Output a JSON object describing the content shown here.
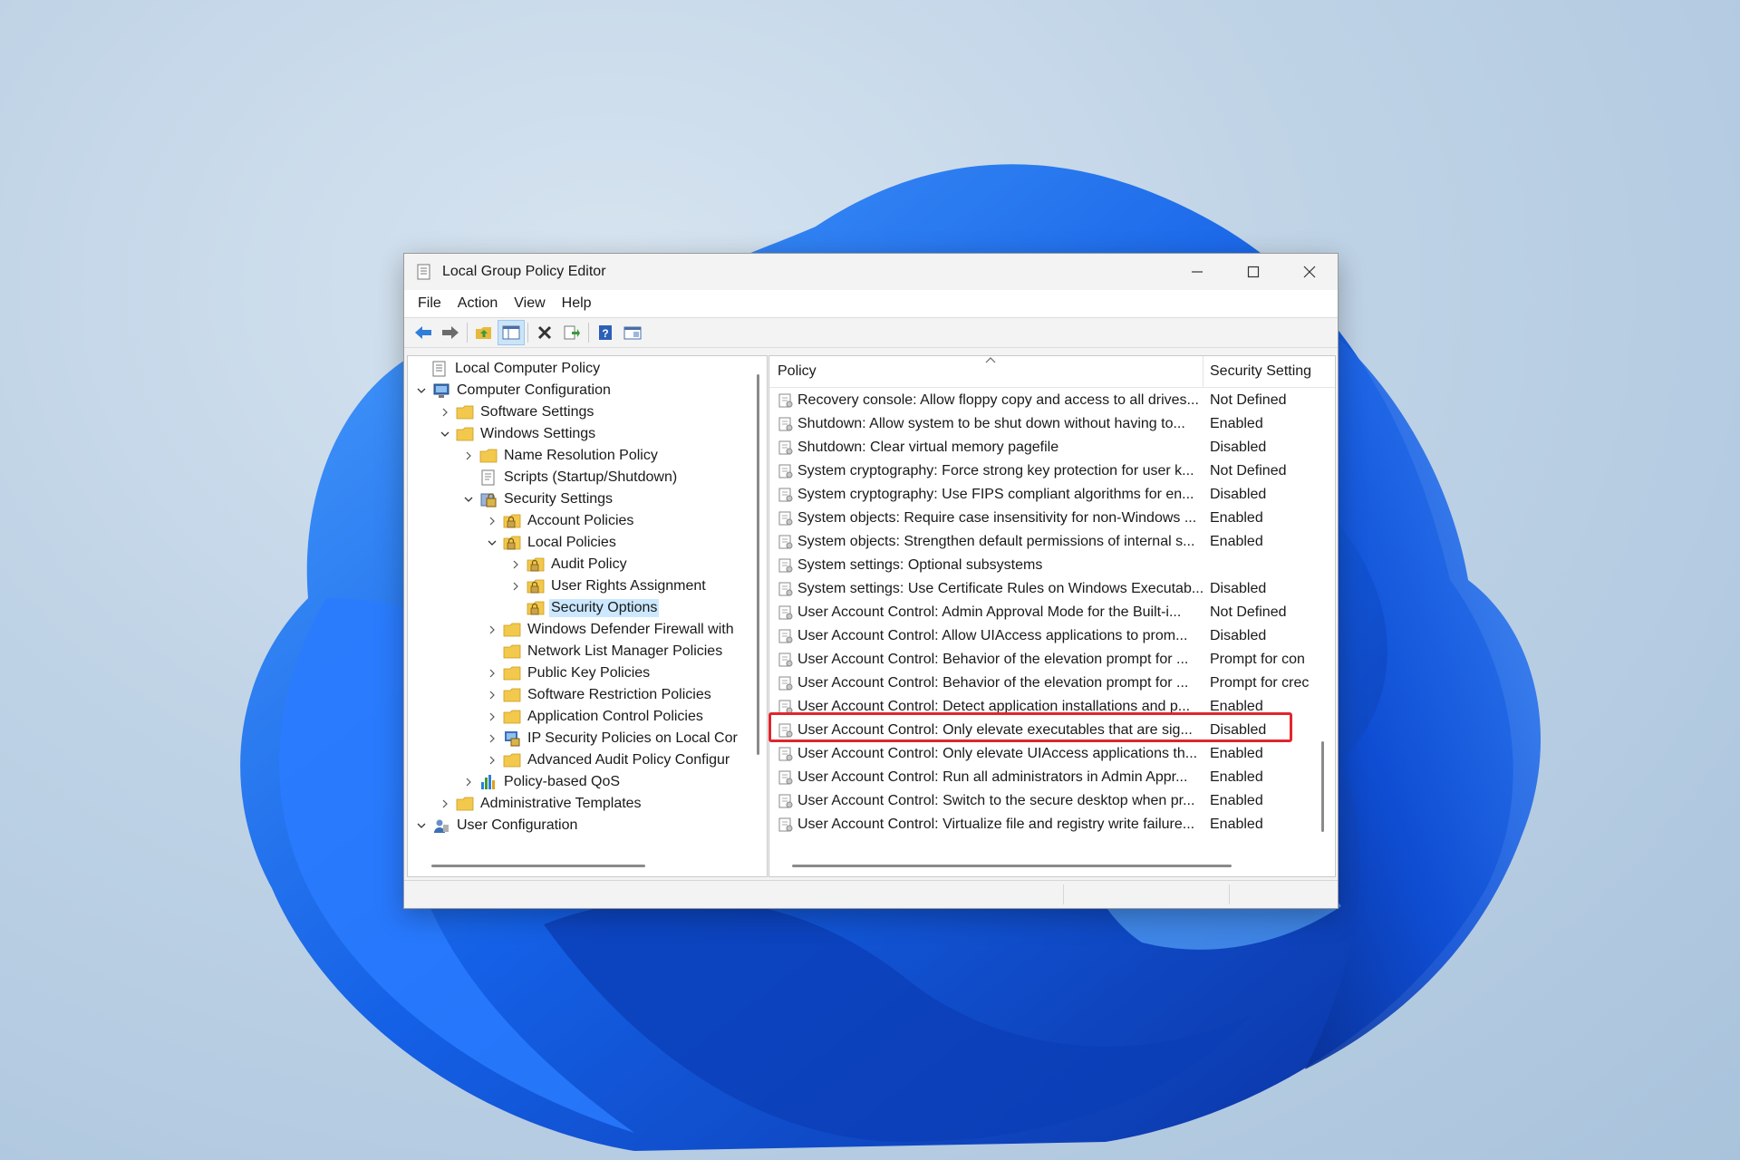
{
  "window": {
    "title": "Local Group Policy Editor",
    "minimize_icon": "minimize-icon",
    "maximize_icon": "maximize-icon",
    "close_icon": "close-icon"
  },
  "menu": [
    "File",
    "Action",
    "View",
    "Help"
  ],
  "toolbar": [
    "back-arrow-icon",
    "forward-arrow-icon",
    "up-folder-icon",
    "show-hide-tree-icon",
    "delete-icon",
    "export-list-icon",
    "help-icon",
    "properties-icon"
  ],
  "tree": [
    {
      "label": "Local Computer Policy",
      "icon": "policy-scroll-icon",
      "chevron": "none"
    },
    {
      "label": "Computer Configuration",
      "icon": "computer-icon",
      "chevron": "down"
    },
    {
      "label": "Software Settings",
      "icon": "folder-icon",
      "chevron": "right"
    },
    {
      "label": "Windows Settings",
      "icon": "folder-icon",
      "chevron": "down"
    },
    {
      "label": "Name Resolution Policy",
      "icon": "folder-icon",
      "chevron": "right"
    },
    {
      "label": "Scripts (Startup/Shutdown)",
      "icon": "script-icon",
      "chevron": "none"
    },
    {
      "label": "Security Settings",
      "icon": "security-settings-icon",
      "chevron": "down"
    },
    {
      "label": "Account Policies",
      "icon": "locked-folder-icon",
      "chevron": "right"
    },
    {
      "label": "Local Policies",
      "icon": "locked-folder-icon",
      "chevron": "down"
    },
    {
      "label": "Audit Policy",
      "icon": "locked-folder-icon",
      "chevron": "right"
    },
    {
      "label": "User Rights Assignment",
      "icon": "locked-folder-icon",
      "chevron": "right"
    },
    {
      "label": "Security Options",
      "icon": "locked-folder-icon",
      "chevron": "none",
      "selected": true
    },
    {
      "label": "Windows Defender Firewall with",
      "icon": "folder-icon",
      "chevron": "right"
    },
    {
      "label": "Network List Manager Policies",
      "icon": "folder-icon",
      "chevron": "none"
    },
    {
      "label": "Public Key Policies",
      "icon": "folder-icon",
      "chevron": "right"
    },
    {
      "label": "Software Restriction Policies",
      "icon": "folder-icon",
      "chevron": "right"
    },
    {
      "label": "Application Control Policies",
      "icon": "folder-icon",
      "chevron": "right"
    },
    {
      "label": "IP Security Policies on Local Cor",
      "icon": "ip-security-icon",
      "chevron": "right"
    },
    {
      "label": "Advanced Audit Policy Configur",
      "icon": "folder-icon",
      "chevron": "right"
    },
    {
      "label": "Policy-based QoS",
      "icon": "bar-chart-icon",
      "chevron": "right"
    },
    {
      "label": "Administrative Templates",
      "icon": "folder-icon",
      "chevron": "right"
    },
    {
      "label": "User Configuration",
      "icon": "user-icon",
      "chevron": "down"
    }
  ],
  "list": {
    "sort_indicator": "sort-ascending-icon",
    "columns": [
      "Policy",
      "Security Setting"
    ],
    "rows": [
      {
        "policy": "Recovery console: Allow floppy copy and access to all drives...",
        "setting": "Not Defined"
      },
      {
        "policy": "Shutdown: Allow system to be shut down without having to...",
        "setting": "Enabled"
      },
      {
        "policy": "Shutdown: Clear virtual memory pagefile",
        "setting": "Disabled"
      },
      {
        "policy": "System cryptography: Force strong key protection for user k...",
        "setting": "Not Defined"
      },
      {
        "policy": "System cryptography: Use FIPS compliant algorithms for en...",
        "setting": "Disabled"
      },
      {
        "policy": "System objects: Require case insensitivity for non-Windows ...",
        "setting": "Enabled"
      },
      {
        "policy": "System objects: Strengthen default permissions of internal s...",
        "setting": "Enabled"
      },
      {
        "policy": "System settings: Optional subsystems",
        "setting": ""
      },
      {
        "policy": "System settings: Use Certificate Rules on Windows Executab...",
        "setting": "Disabled"
      },
      {
        "policy": "User Account Control: Admin Approval Mode for the Built-i...",
        "setting": "Not Defined"
      },
      {
        "policy": "User Account Control: Allow UIAccess applications to prom...",
        "setting": "Disabled"
      },
      {
        "policy": "User Account Control: Behavior of the elevation prompt for ...",
        "setting": "Prompt for con"
      },
      {
        "policy": "User Account Control: Behavior of the elevation prompt for ...",
        "setting": "Prompt for crec"
      },
      {
        "policy": "User Account Control: Detect application installations and p...",
        "setting": "Enabled"
      },
      {
        "policy": "User Account Control: Only elevate executables that are sig...",
        "setting": "Disabled",
        "highlighted": true
      },
      {
        "policy": "User Account Control: Only elevate UIAccess applications th...",
        "setting": "Enabled"
      },
      {
        "policy": "User Account Control: Run all administrators in Admin Appr...",
        "setting": "Enabled"
      },
      {
        "policy": "User Account Control: Switch to the secure desktop when pr...",
        "setting": "Enabled"
      },
      {
        "policy": "User Account Control: Virtualize file and registry write failure...",
        "setting": "Enabled"
      }
    ]
  },
  "colors": {
    "highlight_border": "#e0262c",
    "selection": "#cce8ff",
    "folder": "#f2c94c"
  }
}
